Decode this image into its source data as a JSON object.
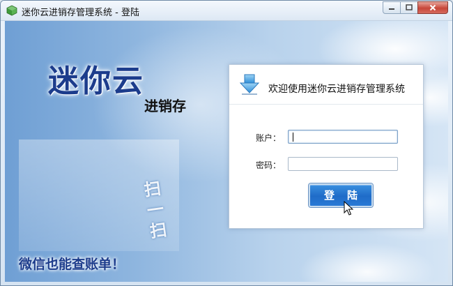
{
  "window": {
    "title": "迷你云进销存管理系统 - 登陆",
    "controls": [
      "minimize",
      "maximize",
      "close"
    ]
  },
  "branding": {
    "logo_main": "迷你云",
    "logo_sub": "进销存",
    "scan_text": [
      "扫",
      "一",
      "扫"
    ],
    "slogan": "微信也能查账单！"
  },
  "login": {
    "header_title": "欢迎使用迷你云进销存管理系统",
    "account_label": "账户：",
    "account_value": "",
    "password_label": "密码：",
    "password_value": "",
    "submit_label": "登陆"
  },
  "colors": {
    "accent": "#1f6cc8",
    "brand_text": "#1c3c8c"
  }
}
